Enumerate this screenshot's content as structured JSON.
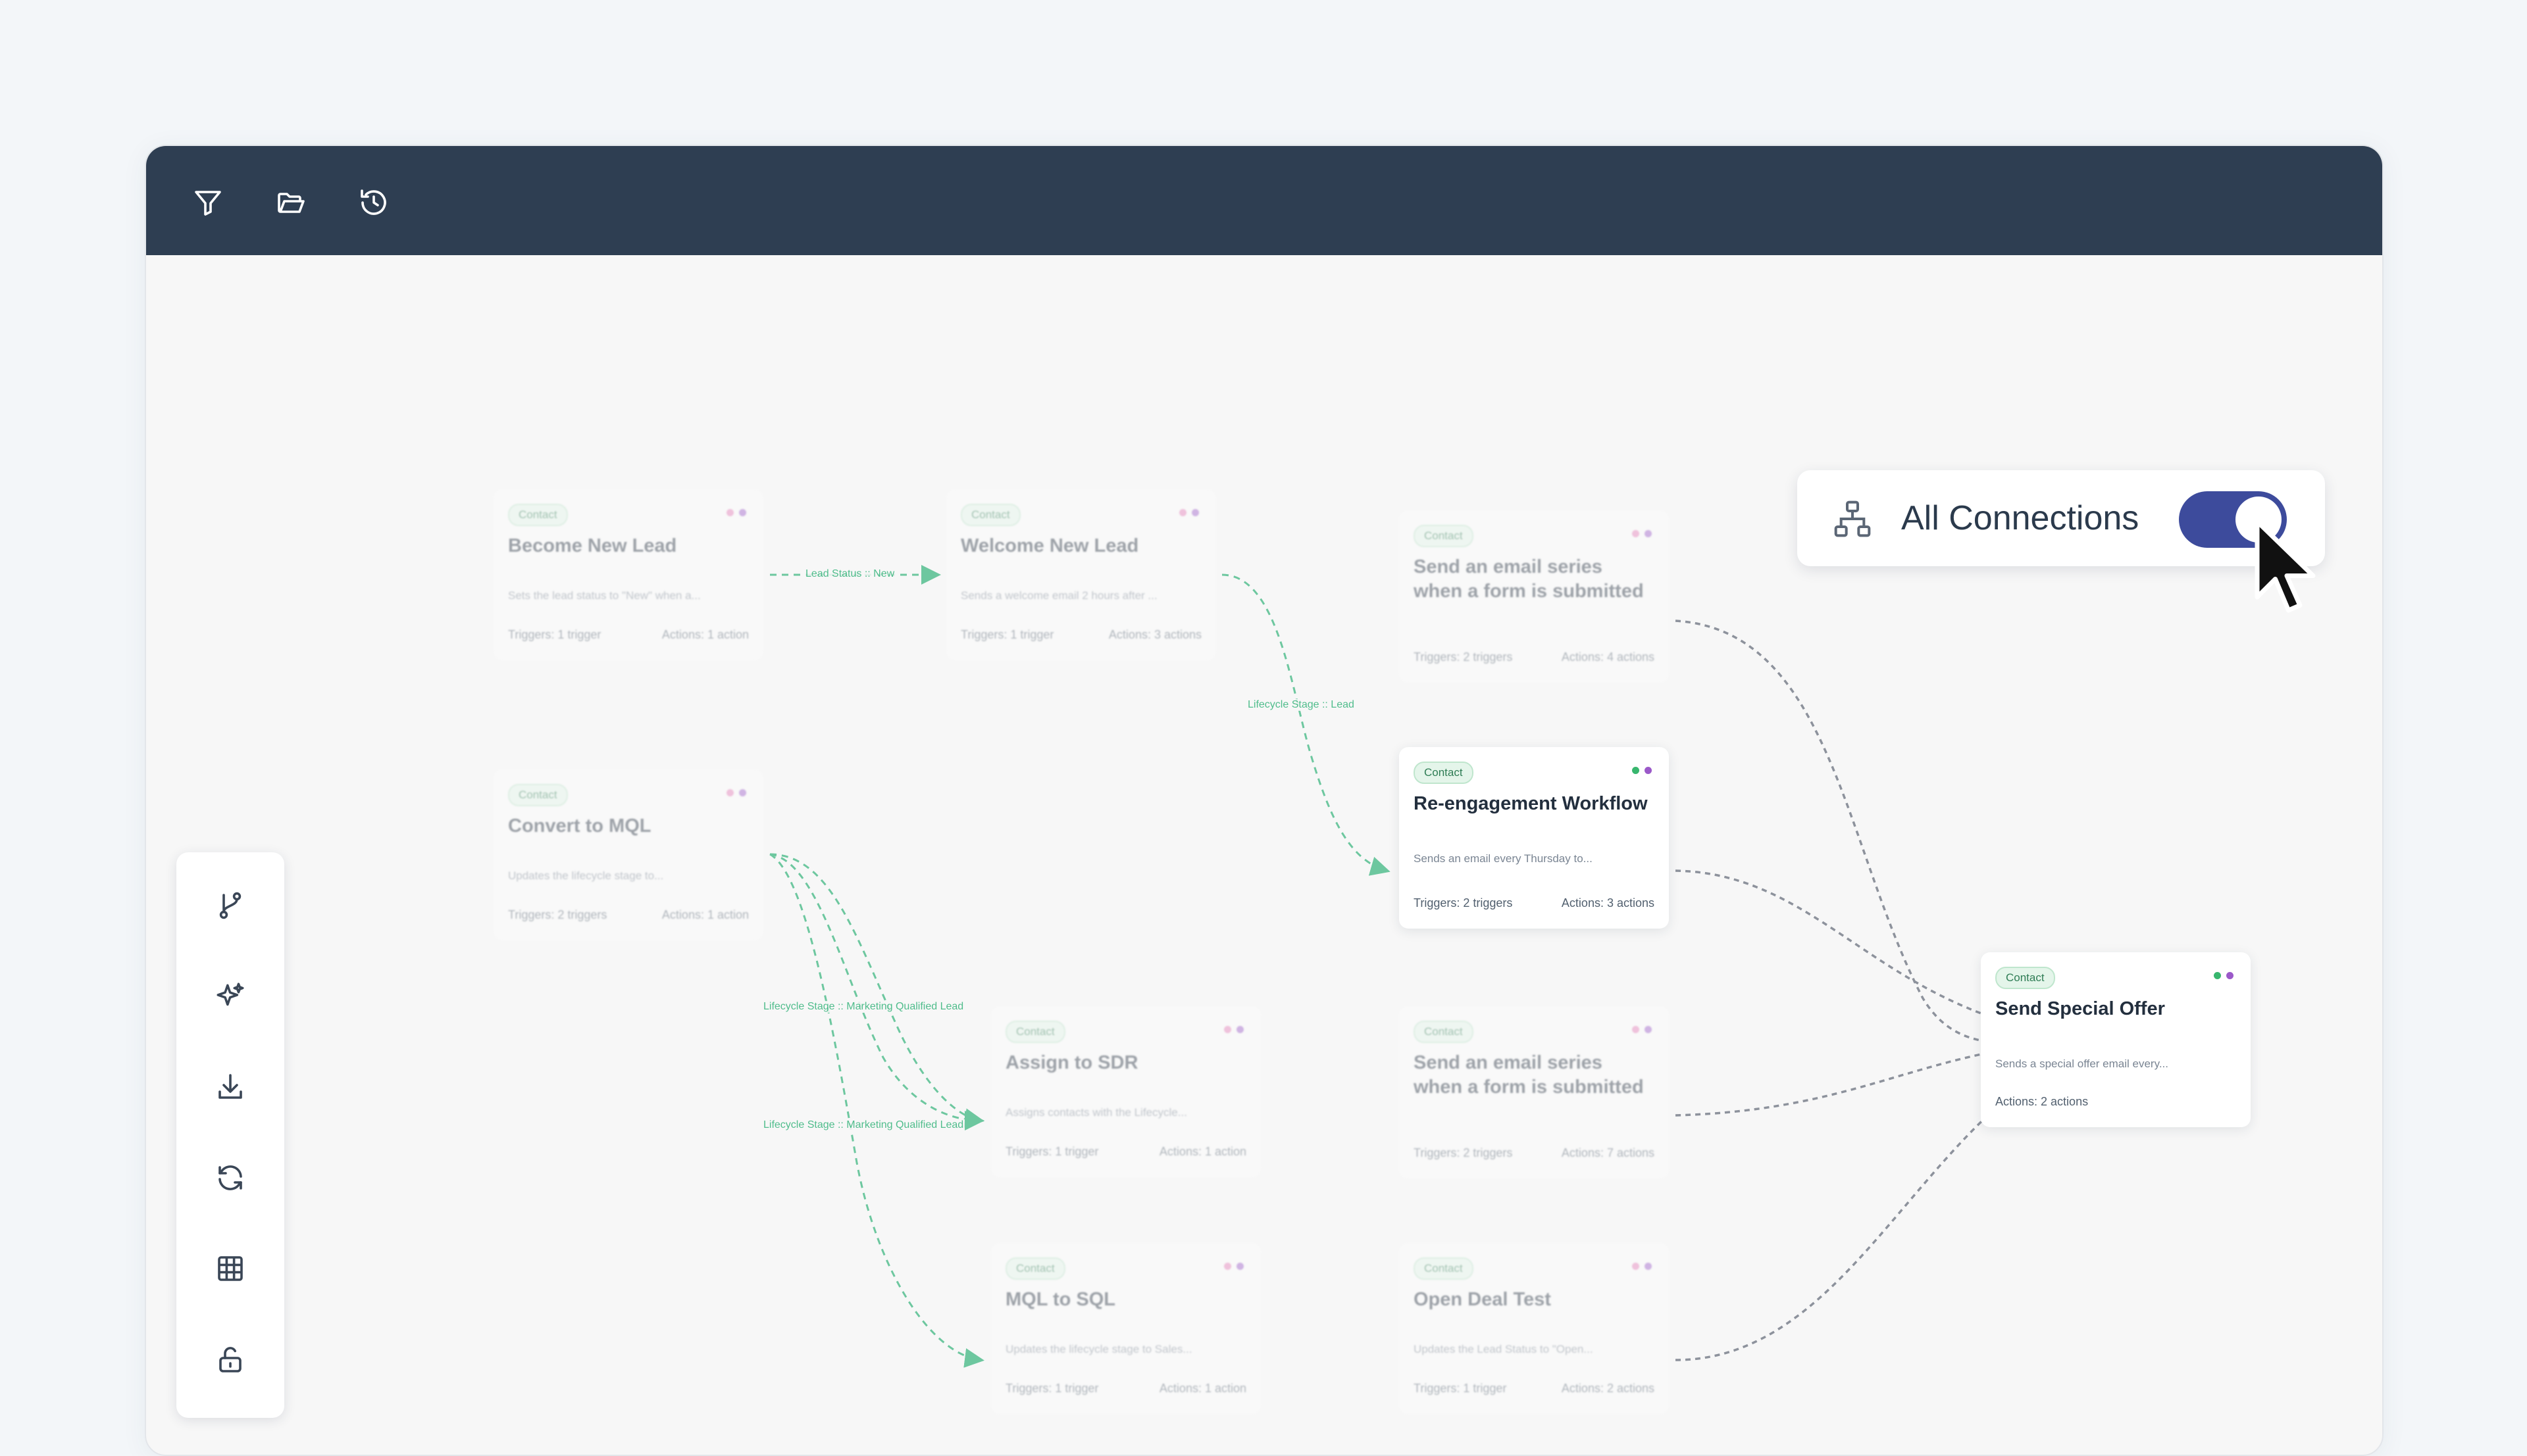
{
  "toolbar": {
    "icons": [
      "filter-icon",
      "folder-open-icon",
      "history-icon"
    ]
  },
  "sidebar": {
    "icons": [
      "branch-icon",
      "sparkles-icon",
      "download-icon",
      "refresh-icon",
      "grid-icon",
      "lock-open-icon"
    ]
  },
  "connections": {
    "label": "All Connections",
    "enabled": true,
    "icon": "hierarchy-icon"
  },
  "edge_labels": {
    "lead_status_new": "Lead Status :: New",
    "lifecycle_stage_lead": "Lifecycle Stage :: Lead",
    "lifecycle_mql_1": "Lifecycle Stage :: Marketing Qualified Lead",
    "lifecycle_mql_2": "Lifecycle Stage :: Marketing Qualified Lead"
  },
  "nodes": {
    "become_new_lead": {
      "tag": "Contact",
      "title": "Become New Lead",
      "desc": "Sets the lead status to \"New\" when a...",
      "triggers": "Triggers: 1 trigger",
      "actions": "Actions: 1 action"
    },
    "welcome_new_lead": {
      "tag": "Contact",
      "title": "Welcome New Lead",
      "desc": "Sends a welcome email 2 hours after ...",
      "triggers": "Triggers: 1 trigger",
      "actions": "Actions: 3 actions"
    },
    "email_series_1": {
      "tag": "Contact",
      "title": "Send an email series when a form is submitted",
      "triggers": "Triggers: 2 triggers",
      "actions": "Actions: 4 actions"
    },
    "convert_to_mql": {
      "tag": "Contact",
      "title": "Convert to MQL",
      "desc": "Updates the lifecycle stage to...",
      "triggers": "Triggers: 2 triggers",
      "actions": "Actions: 1 action"
    },
    "reengagement": {
      "tag": "Contact",
      "title": "Re-engagement Workflow",
      "desc": "Sends an email every Thursday to...",
      "triggers": "Triggers: 2 triggers",
      "actions": "Actions: 3 actions"
    },
    "send_special_offer": {
      "tag": "Contact",
      "title": "Send Special Offer",
      "desc": "Sends a special offer email every...",
      "actions": "Actions: 2 actions"
    },
    "assign_to_sdr": {
      "tag": "Contact",
      "title": "Assign to SDR",
      "desc": "Assigns contacts with the Lifecycle...",
      "triggers": "Triggers: 1 trigger",
      "actions": "Actions: 1 action"
    },
    "email_series_2": {
      "tag": "Contact",
      "title": "Send an email series when a form is submitted",
      "triggers": "Triggers: 2 triggers",
      "actions": "Actions: 7 actions"
    },
    "mql_to_sql": {
      "tag": "Contact",
      "title": "MQL to SQL",
      "desc": "Updates the lifecycle stage to Sales...",
      "triggers": "Triggers: 1 trigger",
      "actions": "Actions: 1 action"
    },
    "open_deal_test": {
      "tag": "Contact",
      "title": "Open Deal Test",
      "desc": "Updates the Lead Status to \"Open...",
      "triggers": "Triggers: 1 trigger",
      "actions": "Actions: 2 actions"
    }
  },
  "colors": {
    "topbar": "#2e3e52",
    "toggle_on": "#3d4b9c",
    "edge_active": "#34b37a",
    "edge_inactive": "#8d929c",
    "dot_pink": "#e67ab8",
    "dot_green": "#38b66e",
    "dot_purple": "#9b59c9"
  }
}
